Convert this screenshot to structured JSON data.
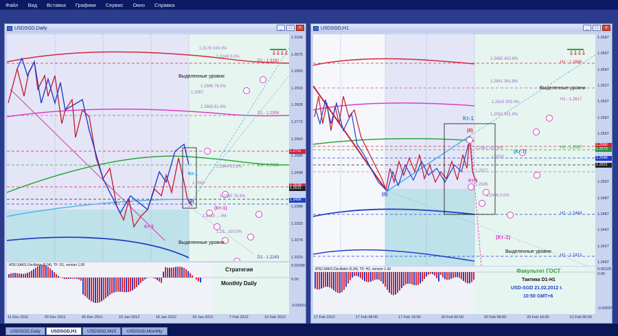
{
  "menu": [
    "Файл",
    "Вид",
    "Вставка",
    "Графики",
    "Сервис",
    "Окно",
    "Справка"
  ],
  "left_window": {
    "title": "USDSGD,Daily",
    "indicator_label": "ATEI.SAKS.Oscillator (5.34), TF: D1, version 1.00",
    "price_ticks": [
      "1.3158",
      "1.3075",
      "1.2993",
      "1.2910",
      "1.2828",
      "1.2773",
      "1.2663",
      "1.2580",
      "1.2498",
      "1.2443",
      "1.2388",
      "1.2333",
      "1.2278",
      "1.2223"
    ],
    "osc_ticks": [
      "0.02398",
      "0.00",
      "-0.02561"
    ],
    "x_ticks": [
      "11 Dec 2011",
      "20 Dec 2011",
      "30 Dec 2011",
      "10 Jan 2012",
      "19 Jan 2012",
      "29 Jan 2012",
      "7 Feb 2012",
      "16 Feb 2012"
    ],
    "price_flags": [
      {
        "text": "1.2711",
        "color": "#d4233a"
      },
      {
        "text": "1.2538",
        "color": "#d4233a"
      },
      {
        "text": "1.2512",
        "color": "#222"
      },
      {
        "text": "1.2496",
        "color": "#1f3fc9"
      }
    ],
    "fib_labels": [
      {
        "text": "1.3176  100.0%"
      },
      {
        "text": "1.3149   0.0%"
      },
      {
        "text": "1.2996  76.4%"
      },
      {
        "text": "1.2967"
      },
      {
        "text": "1.2883  61.8%"
      },
      {
        "text": "1.2644  61.8%"
      },
      {
        "text": "1.2562"
      },
      {
        "text": "1.2480  76.4%"
      },
      {
        "text": "1.2410  ... 4%"
      },
      {
        "text": "1.23..  100.0%"
      }
    ],
    "level_labels": [
      {
        "text": "D1 - 1.3182"
      },
      {
        "text": "D1 - 1.2906"
      },
      {
        "text": "D1 - 1.2685"
      },
      {
        "text": "D1 - 1.2243"
      }
    ],
    "texts": {
      "levels_top": "Выделенные уровни",
      "levels_bottom": "Выделенные уровни",
      "kt1": "Кт-1",
      "kt3": "Кт-3",
      "kt1b": "(Кт-1)",
      "zero": "(0)",
      "strategy": "Стратегия",
      "monthly": "Monthly Daily"
    }
  },
  "right_window": {
    "title": "USDSGD,H1",
    "indicator_label": "ATEI.SAKS.Oscillator (5.34), TF: H1, version 1.00",
    "price_ticks": [
      "1.2687",
      "1.2667",
      "1.2647",
      "1.2627",
      "1.2607",
      "1.2587",
      "1.2567",
      "1.2547",
      "1.2527",
      "1.2507",
      "1.2487",
      "1.2467",
      "1.2447",
      "1.2427",
      "1.2407"
    ],
    "osc_ticks": [
      "0.00126",
      "0.00",
      "-0.00597"
    ],
    "x_ticks": [
      "17 Feb 2012",
      "17 Feb 08:00",
      "17 Feb 16:00",
      "20 Feb 00:00",
      "20 Feb 08:00",
      "20 Feb 16:00",
      "21 Feb 00:00"
    ],
    "price_flags": [
      {
        "text": "1.2580",
        "color": "#d4233a"
      },
      {
        "text": "1.2573",
        "color": "#229a3c"
      },
      {
        "text": "1.2546",
        "color": "#1f3fc9"
      },
      {
        "text": "1.2521",
        "color": "#222"
      }
    ],
    "fib_labels": [
      {
        "text": "1.2665  423.6%"
      },
      {
        "text": "1.2641  361.8%"
      },
      {
        "text": "1.2616  300.0%"
      },
      {
        "text": "1.2592  261.8%"
      },
      {
        "text": "1.2561  161.8%"
      },
      {
        "text": "1.2537"
      },
      {
        "text": "1.2527"
      },
      {
        "text": "1.2505"
      },
      {
        "text": "1.2496   0.0%"
      }
    ],
    "level_labels": [
      {
        "text": "H1 - 1.2668"
      },
      {
        "text": "H1 - 1.2617"
      },
      {
        "text": "H1 - 1.2567"
      },
      {
        "text": "H1 - 1.2464"
      },
      {
        "text": "H1 - 1.2413"
      }
    ],
    "texts": {
      "levels_top": "Выделенные уровни",
      "levels_bottom": "Выделенные уровни",
      "kt1": "Кт-1",
      "kt1b": "(Кт-1)",
      "kt1c": "Кт-1",
      "kt1d": "(Кт-1)",
      "zero_top": "(0)",
      "zero_bottom": "(0)",
      "faculty": "Факультет ГОСТ",
      "tactic": "Тактика D1-H1",
      "pair_date": "USD-SGD  21.02.2012 г.",
      "time": "10:50  GMT+6"
    }
  },
  "tabs": [
    "USDSGD,Daily",
    "USDSGD,H1",
    "USDSGD,M15",
    "USDSGD,Monthly"
  ],
  "active_tab": 1,
  "colors": {
    "red": "#d4233a",
    "pink": "#e04cc8",
    "green": "#2aa53a",
    "blue": "#1f3fc9",
    "lightblue": "#4fb4e6",
    "teal_bg": "#bfe1ea",
    "mint_bg": "#e6f5ef",
    "lav_bg": "#e4e6f7"
  }
}
